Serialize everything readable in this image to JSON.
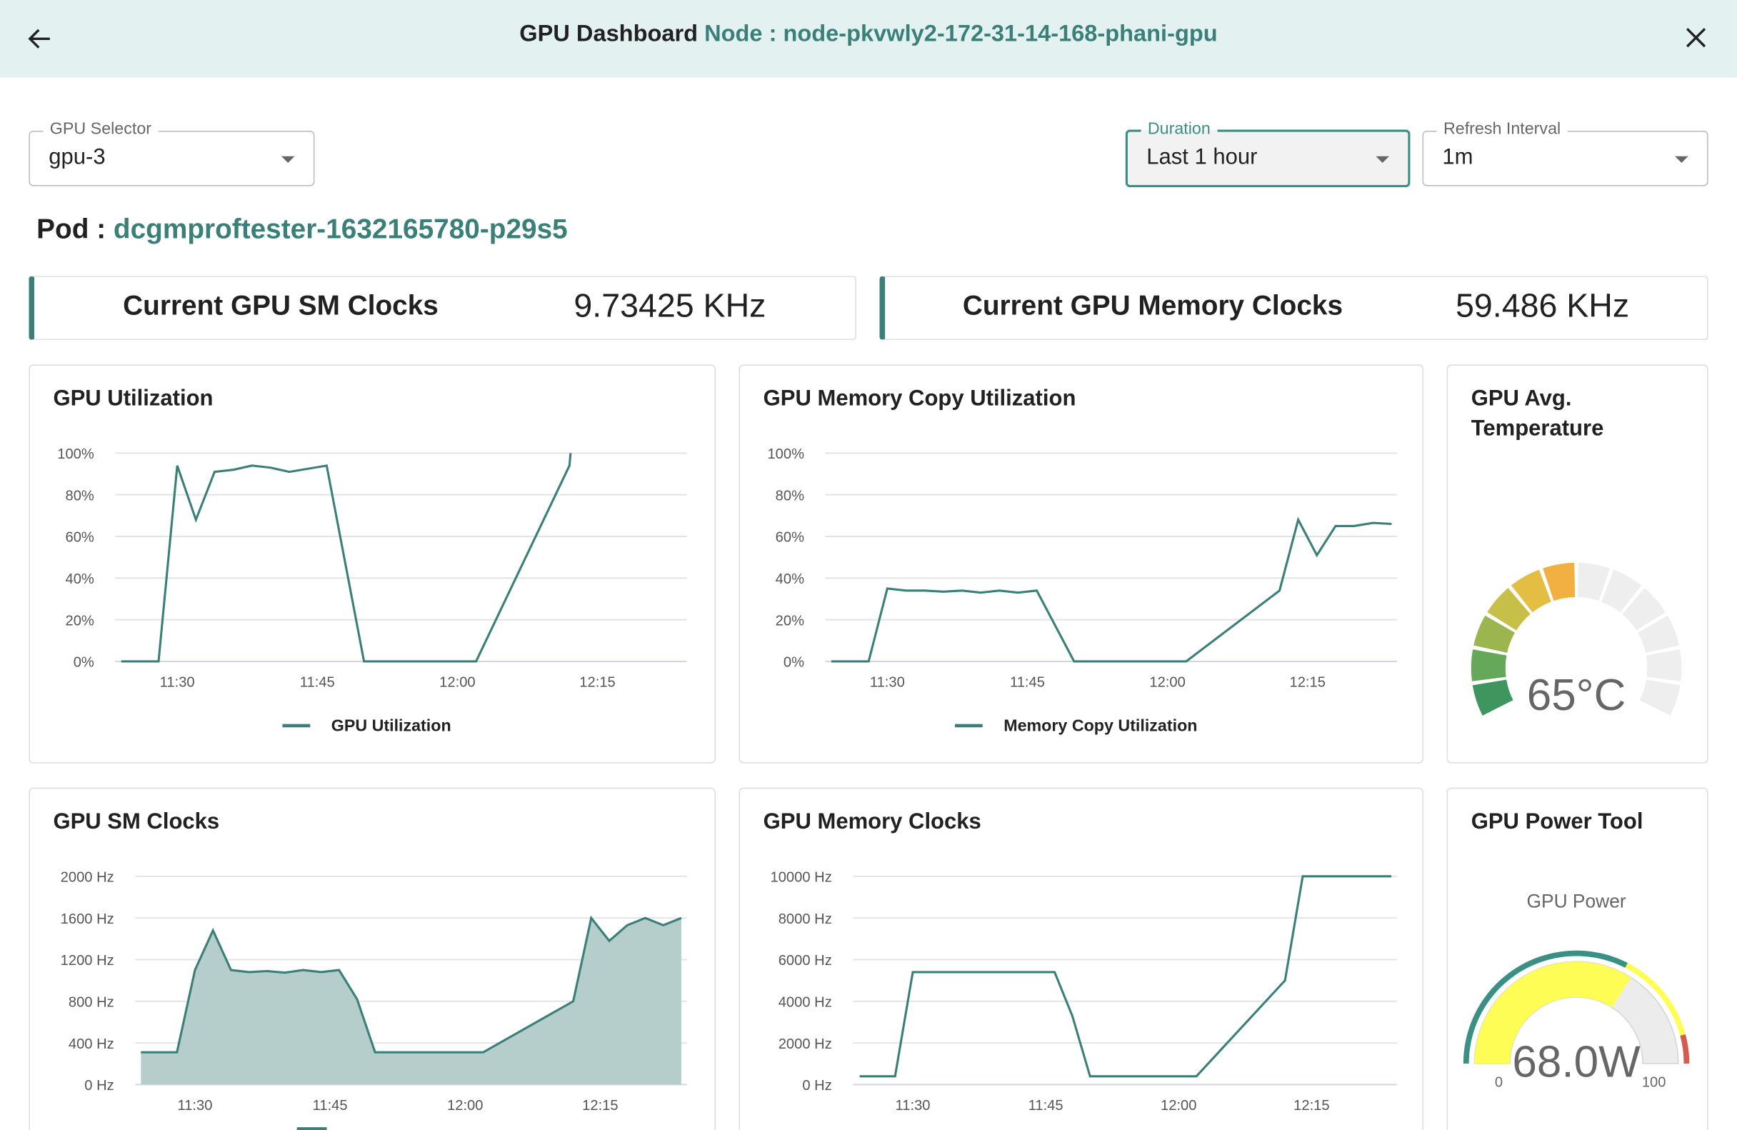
{
  "header": {
    "title": "GPU Dashboard",
    "node_label": "Node : node-pkvwly2-172-31-14-168-phani-gpu",
    "back_icon": "arrow-left-icon",
    "close_icon": "close-icon"
  },
  "controls": {
    "gpu_selector": {
      "label": "GPU Selector",
      "value": "gpu-3"
    },
    "duration": {
      "label": "Duration",
      "value": "Last 1 hour"
    },
    "refresh_interval": {
      "label": "Refresh Interval",
      "value": "1m"
    }
  },
  "pod": {
    "label": "Pod :",
    "name": "dcgmproftester-1632165780-p29s5"
  },
  "stats": [
    {
      "label": "Current GPU SM Clocks",
      "value": "9.73425 KHz"
    },
    {
      "label": "Current GPU Memory Clocks",
      "value": "59.486 KHz"
    }
  ],
  "colors": {
    "accent": "#3a7f78",
    "header_bg": "#e3f2f0",
    "area_fill": "#b5cdcb"
  },
  "chart_data": [
    {
      "id": "gpu_util",
      "type": "line",
      "title": "GPU Utilization",
      "legend": "GPU Utilization",
      "legend_position": "bottom",
      "grid": true,
      "yticks": [
        "0%",
        "20%",
        "40%",
        "60%",
        "80%",
        "100%"
      ],
      "ylim": [
        0,
        100
      ],
      "xticks": [
        "11:30",
        "11:45",
        "12:00",
        "12:15"
      ],
      "x": [
        "11:24",
        "11:28",
        "11:30",
        "11:32",
        "11:34",
        "11:36",
        "11:38",
        "11:40",
        "11:42",
        "11:46",
        "11:50",
        "12:02",
        "12:12",
        "12:12"
      ],
      "values": [
        0,
        0,
        94,
        68,
        91,
        92,
        94,
        93,
        91,
        94,
        0,
        0,
        94,
        100
      ]
    },
    {
      "id": "mem_copy",
      "type": "line",
      "title": "GPU Memory Copy Utilization",
      "legend": "Memory Copy Utilization",
      "legend_position": "bottom",
      "grid": true,
      "yticks": [
        "0%",
        "20%",
        "40%",
        "60%",
        "80%",
        "100%"
      ],
      "ylim": [
        0,
        100
      ],
      "xticks": [
        "11:30",
        "11:45",
        "12:00",
        "12:15"
      ],
      "x": [
        "11:24",
        "11:28",
        "11:30",
        "11:32",
        "11:34",
        "11:36",
        "11:38",
        "11:40",
        "11:42",
        "11:44",
        "11:46",
        "11:50",
        "12:02",
        "12:12",
        "12:14",
        "12:16",
        "12:18",
        "12:20",
        "12:22",
        "12:24"
      ],
      "values": [
        0,
        0,
        35,
        34,
        34,
        33.5,
        34,
        33,
        34,
        33,
        34,
        0,
        0,
        34,
        68,
        51,
        65,
        65,
        66.5,
        66
      ]
    },
    {
      "id": "sm_clocks",
      "type": "area",
      "title": "GPU SM Clocks",
      "grid": true,
      "yticks": [
        "0 Hz",
        "400 Hz",
        "800 Hz",
        "1200 Hz",
        "1600 Hz",
        "2000 Hz"
      ],
      "ylim": [
        0,
        2000
      ],
      "xticks": [
        "11:30",
        "11:45",
        "12:00",
        "12:15"
      ],
      "x": [
        "11:24",
        "11:28",
        "11:30",
        "11:32",
        "11:34",
        "11:36",
        "11:38",
        "11:40",
        "11:42",
        "11:44",
        "11:46",
        "11:48",
        "11:50",
        "12:02",
        "12:12",
        "12:14",
        "12:16",
        "12:18",
        "12:20",
        "12:22",
        "12:24"
      ],
      "values": [
        310,
        310,
        1100,
        1480,
        1100,
        1080,
        1090,
        1075,
        1100,
        1080,
        1100,
        820,
        310,
        310,
        800,
        1600,
        1380,
        1530,
        1600,
        1530,
        1600
      ]
    },
    {
      "id": "mem_clocks",
      "type": "line",
      "title": "GPU Memory Clocks",
      "grid": true,
      "yticks": [
        "0 Hz",
        "2000 Hz",
        "4000 Hz",
        "6000 Hz",
        "8000 Hz",
        "10000 Hz"
      ],
      "ylim": [
        0,
        10000
      ],
      "xticks": [
        "11:30",
        "11:45",
        "12:00",
        "12:15"
      ],
      "x": [
        "11:24",
        "11:28",
        "11:30",
        "11:46",
        "11:48",
        "11:50",
        "12:02",
        "12:12",
        "12:14",
        "12:24"
      ],
      "values": [
        400,
        400,
        5400,
        5400,
        3300,
        400,
        400,
        5000,
        10000,
        10000
      ]
    }
  ],
  "temperature": {
    "title": "GPU Avg. Temperature",
    "value_text": "65°C",
    "segments_total": 12,
    "segments_filled": 6,
    "segment_colors": [
      "#3f955e",
      "#66a85a",
      "#9bb54f",
      "#c6bf48",
      "#e3be42",
      "#f2b043"
    ],
    "empty_color": "#eeeeee"
  },
  "power": {
    "title": "GPU Power Tool",
    "subtitle": "GPU Power",
    "value_text": "68.0W",
    "value": 68,
    "min": 0,
    "max": 100,
    "min_label": "0",
    "max_label": "100",
    "fill_color": "#fdfd55",
    "empty_color": "#ececec",
    "band_colors": [
      "#3a9084",
      "#fdfd55",
      "#d65a4f"
    ]
  }
}
